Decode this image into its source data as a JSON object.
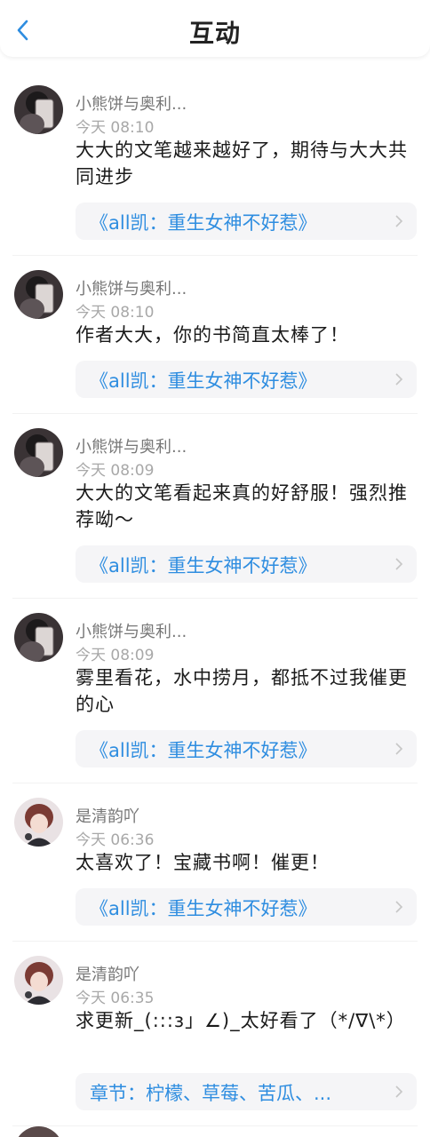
{
  "header": {
    "title": "互动",
    "back_icon": "chevron-left-icon",
    "accent_color": "#2e8de0"
  },
  "comments": [
    {
      "user": "小熊饼与奥利...",
      "time": "今天 08:10",
      "text": "大大的文笔越来越好了，期待与大大共同进步",
      "link": "《all凯：重生女神不好惹》",
      "link_type": "book"
    },
    {
      "user": "小熊饼与奥利...",
      "time": "今天 08:10",
      "text": "作者大大，你的书简直太棒了！",
      "link": "《all凯：重生女神不好惹》",
      "link_type": "book"
    },
    {
      "user": "小熊饼与奥利...",
      "time": "今天 08:09",
      "text": "大大的文笔看起来真的好舒服！强烈推荐呦～",
      "link": "《all凯：重生女神不好惹》",
      "link_type": "book"
    },
    {
      "user": "小熊饼与奥利...",
      "time": "今天 08:09",
      "text": "雾里看花，水中捞月，都抵不过我催更的心",
      "link": "《all凯：重生女神不好惹》",
      "link_type": "book"
    },
    {
      "user": "是清韵吖",
      "time": "今天 06:36",
      "text": "太喜欢了！宝藏书啊！催更！",
      "link": "《all凯：重生女神不好惹》",
      "link_type": "book"
    },
    {
      "user": "是清韵吖",
      "time": "今天 06:35",
      "text": "求更新_(:::з」∠)_太好看了（*/∇\\*）",
      "link": "章节：柠檬、草莓、苦瓜、...",
      "link_type": "chapter"
    }
  ]
}
